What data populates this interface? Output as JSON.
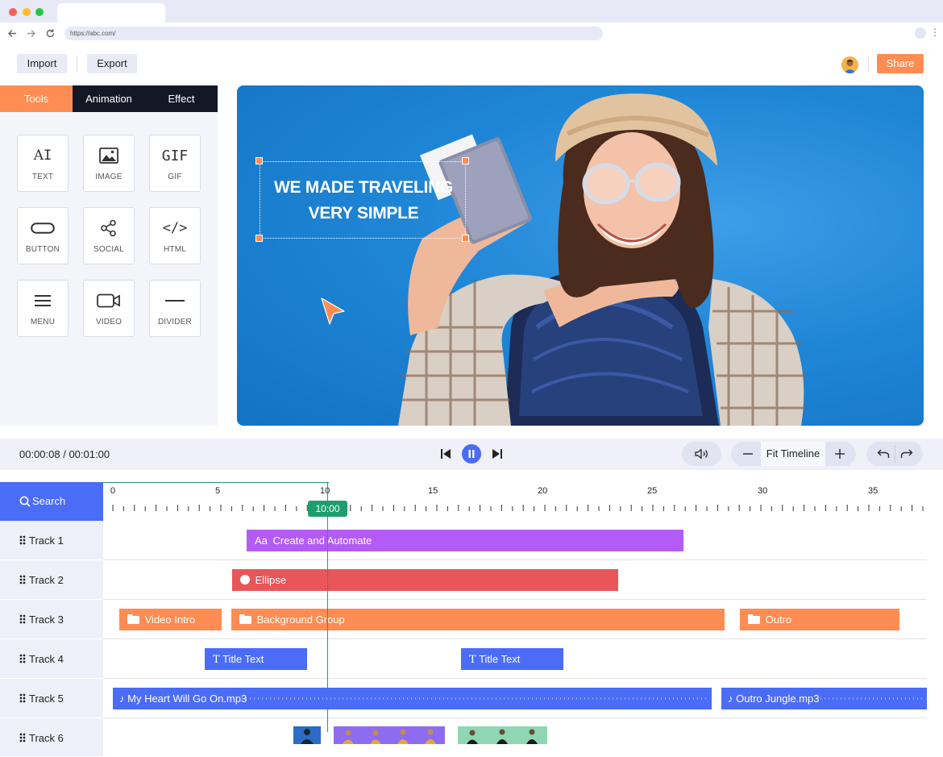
{
  "browser": {
    "url": "https://abc.com/",
    "back_icon": "arrow-left-icon",
    "forward_icon": "arrow-right-icon",
    "reload_icon": "reload-icon",
    "menu_icon": "more-vertical-icon"
  },
  "header": {
    "import_label": "Import",
    "export_label": "Export",
    "share_label": "Share"
  },
  "panel": {
    "tabs": [
      {
        "label": "Tools",
        "active": true
      },
      {
        "label": "Animation",
        "active": false
      },
      {
        "label": "Effect",
        "active": false
      }
    ],
    "tools": [
      {
        "label": "TEXT",
        "icon": "text-icon"
      },
      {
        "label": "IMAGE",
        "icon": "image-icon"
      },
      {
        "label": "GIF",
        "icon": "gif-icon"
      },
      {
        "label": "BUTTON",
        "icon": "button-icon"
      },
      {
        "label": "SOCIAL",
        "icon": "share-icon"
      },
      {
        "label": "HTML",
        "icon": "code-icon"
      },
      {
        "label": "MENU",
        "icon": "menu-icon"
      },
      {
        "label": "VIDEO",
        "icon": "video-icon"
      },
      {
        "label": "DIVIDER",
        "icon": "divider-icon"
      }
    ]
  },
  "canvas": {
    "headline_line1": "WE MADE TRAVELING",
    "headline_line2": "VERY SIMPLE"
  },
  "transport": {
    "current_time": "00:00:08",
    "total_time": "00:01:00",
    "fit_label": "Fit Timeline"
  },
  "timeline": {
    "search_label": "Search",
    "ruler_ticks": [
      "0",
      "5",
      "10",
      "15",
      "20",
      "25",
      "30",
      "35"
    ],
    "playhead_label": "10:00",
    "tracks": [
      {
        "label": "Track 1"
      },
      {
        "label": "Track 2"
      },
      {
        "label": "Track 3"
      },
      {
        "label": "Track 4"
      },
      {
        "label": "Track 5"
      },
      {
        "label": "Track 6"
      }
    ],
    "clips": {
      "create_automate": "Create and Automate",
      "create_automate_prefix": "Aa",
      "ellipse": "Ellipse",
      "video_intro": "Video Intro",
      "background_group": "Background Group",
      "outro": "Outro",
      "title_text_1": "Title Text",
      "title_text_2": "Title Text",
      "audio_1": "My Heart Will Go On.mp3",
      "audio_2": "Outro Jungle.mp3"
    }
  },
  "colors": {
    "accent_orange": "#ff8c52",
    "accent_blue": "#4a6cf7",
    "purple": "#b35cf5",
    "red": "#e8565a",
    "green": "#1f9d6e",
    "dark_tab": "#141826"
  }
}
